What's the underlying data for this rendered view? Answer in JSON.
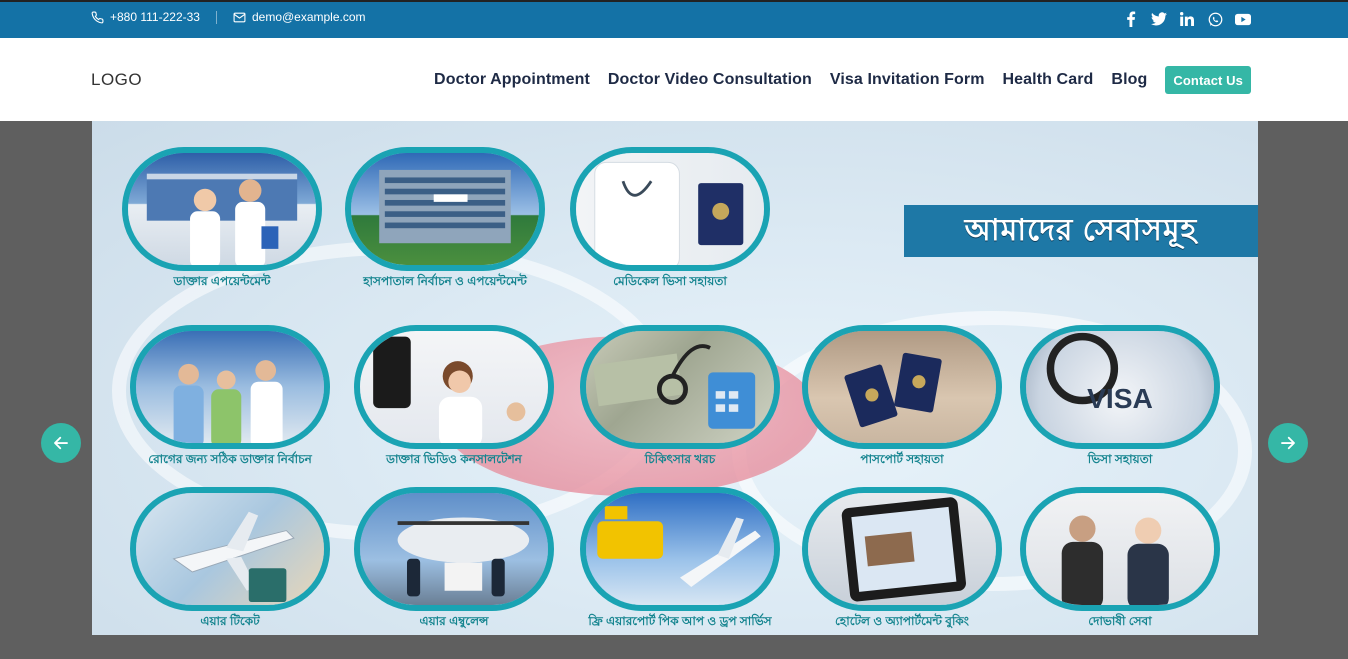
{
  "topbar": {
    "phone": "+880 111-222-33",
    "email": "demo@example.com",
    "social_icons": [
      "facebook-icon",
      "twitter-icon",
      "linkedin-icon",
      "whatsapp-icon",
      "youtube-icon"
    ]
  },
  "navbar": {
    "logo": "LOGO",
    "menu": [
      "Doctor Appointment",
      "Doctor Video Consultation",
      "Visa Invitation Form",
      "Health Card",
      "Blog"
    ],
    "cta": "Contact Us"
  },
  "slide": {
    "banner": "আমাদের সেবাসমূহ",
    "services": [
      {
        "caption": "ডাক্তার এপয়েন্টমেন্ট"
      },
      {
        "caption": "হাসপাতাল নির্বাচন ও এপয়েন্টমেন্ট"
      },
      {
        "caption": "মেডিকেল ভিসা সহায়তা"
      },
      {
        "caption": "রোগের জন্য সঠিক ডাক্তার নির্বাচন"
      },
      {
        "caption": "ডাক্তার ভিডিও কনসালটেশন"
      },
      {
        "caption": "চিকিৎসার খরচ"
      },
      {
        "caption": "পাসপোর্ট সহায়তা"
      },
      {
        "caption": "ভিসা সহায়তা"
      },
      {
        "caption": "এয়ার টিকেট"
      },
      {
        "caption": "এয়ার এম্বুলেন্স"
      },
      {
        "caption": "ফ্রি এয়ারপোর্ট পিক আপ ও ড্রপ সার্ভিস"
      },
      {
        "caption": "হোটেল ও অ্যাপার্টমেন্ট বুকিং"
      },
      {
        "caption": "দোভাষী সেবা"
      }
    ]
  },
  "colors": {
    "topbar": "#1472a6",
    "accent": "#35b7a6",
    "nav_text": "#1e2a45",
    "caption": "#14848f"
  }
}
